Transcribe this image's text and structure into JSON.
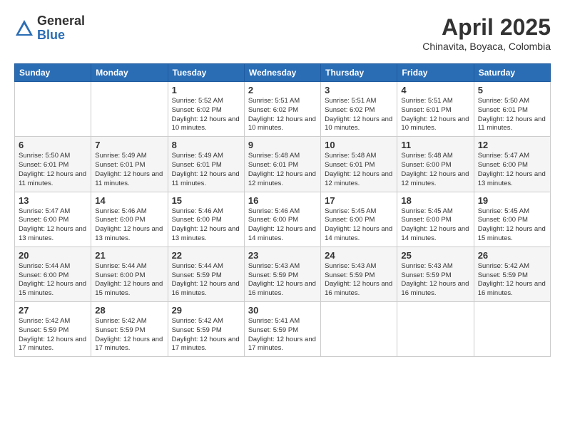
{
  "header": {
    "logo_general": "General",
    "logo_blue": "Blue",
    "month_year": "April 2025",
    "location": "Chinavita, Boyaca, Colombia"
  },
  "days_of_week": [
    "Sunday",
    "Monday",
    "Tuesday",
    "Wednesday",
    "Thursday",
    "Friday",
    "Saturday"
  ],
  "weeks": [
    [
      {
        "day": "",
        "info": ""
      },
      {
        "day": "",
        "info": ""
      },
      {
        "day": "1",
        "info": "Sunrise: 5:52 AM\nSunset: 6:02 PM\nDaylight: 12 hours and 10 minutes."
      },
      {
        "day": "2",
        "info": "Sunrise: 5:51 AM\nSunset: 6:02 PM\nDaylight: 12 hours and 10 minutes."
      },
      {
        "day": "3",
        "info": "Sunrise: 5:51 AM\nSunset: 6:02 PM\nDaylight: 12 hours and 10 minutes."
      },
      {
        "day": "4",
        "info": "Sunrise: 5:51 AM\nSunset: 6:01 PM\nDaylight: 12 hours and 10 minutes."
      },
      {
        "day": "5",
        "info": "Sunrise: 5:50 AM\nSunset: 6:01 PM\nDaylight: 12 hours and 11 minutes."
      }
    ],
    [
      {
        "day": "6",
        "info": "Sunrise: 5:50 AM\nSunset: 6:01 PM\nDaylight: 12 hours and 11 minutes."
      },
      {
        "day": "7",
        "info": "Sunrise: 5:49 AM\nSunset: 6:01 PM\nDaylight: 12 hours and 11 minutes."
      },
      {
        "day": "8",
        "info": "Sunrise: 5:49 AM\nSunset: 6:01 PM\nDaylight: 12 hours and 11 minutes."
      },
      {
        "day": "9",
        "info": "Sunrise: 5:48 AM\nSunset: 6:01 PM\nDaylight: 12 hours and 12 minutes."
      },
      {
        "day": "10",
        "info": "Sunrise: 5:48 AM\nSunset: 6:01 PM\nDaylight: 12 hours and 12 minutes."
      },
      {
        "day": "11",
        "info": "Sunrise: 5:48 AM\nSunset: 6:00 PM\nDaylight: 12 hours and 12 minutes."
      },
      {
        "day": "12",
        "info": "Sunrise: 5:47 AM\nSunset: 6:00 PM\nDaylight: 12 hours and 13 minutes."
      }
    ],
    [
      {
        "day": "13",
        "info": "Sunrise: 5:47 AM\nSunset: 6:00 PM\nDaylight: 12 hours and 13 minutes."
      },
      {
        "day": "14",
        "info": "Sunrise: 5:46 AM\nSunset: 6:00 PM\nDaylight: 12 hours and 13 minutes."
      },
      {
        "day": "15",
        "info": "Sunrise: 5:46 AM\nSunset: 6:00 PM\nDaylight: 12 hours and 13 minutes."
      },
      {
        "day": "16",
        "info": "Sunrise: 5:46 AM\nSunset: 6:00 PM\nDaylight: 12 hours and 14 minutes."
      },
      {
        "day": "17",
        "info": "Sunrise: 5:45 AM\nSunset: 6:00 PM\nDaylight: 12 hours and 14 minutes."
      },
      {
        "day": "18",
        "info": "Sunrise: 5:45 AM\nSunset: 6:00 PM\nDaylight: 12 hours and 14 minutes."
      },
      {
        "day": "19",
        "info": "Sunrise: 5:45 AM\nSunset: 6:00 PM\nDaylight: 12 hours and 15 minutes."
      }
    ],
    [
      {
        "day": "20",
        "info": "Sunrise: 5:44 AM\nSunset: 6:00 PM\nDaylight: 12 hours and 15 minutes."
      },
      {
        "day": "21",
        "info": "Sunrise: 5:44 AM\nSunset: 6:00 PM\nDaylight: 12 hours and 15 minutes."
      },
      {
        "day": "22",
        "info": "Sunrise: 5:44 AM\nSunset: 5:59 PM\nDaylight: 12 hours and 16 minutes."
      },
      {
        "day": "23",
        "info": "Sunrise: 5:43 AM\nSunset: 5:59 PM\nDaylight: 12 hours and 16 minutes."
      },
      {
        "day": "24",
        "info": "Sunrise: 5:43 AM\nSunset: 5:59 PM\nDaylight: 12 hours and 16 minutes."
      },
      {
        "day": "25",
        "info": "Sunrise: 5:43 AM\nSunset: 5:59 PM\nDaylight: 12 hours and 16 minutes."
      },
      {
        "day": "26",
        "info": "Sunrise: 5:42 AM\nSunset: 5:59 PM\nDaylight: 12 hours and 16 minutes."
      }
    ],
    [
      {
        "day": "27",
        "info": "Sunrise: 5:42 AM\nSunset: 5:59 PM\nDaylight: 12 hours and 17 minutes."
      },
      {
        "day": "28",
        "info": "Sunrise: 5:42 AM\nSunset: 5:59 PM\nDaylight: 12 hours and 17 minutes."
      },
      {
        "day": "29",
        "info": "Sunrise: 5:42 AM\nSunset: 5:59 PM\nDaylight: 12 hours and 17 minutes."
      },
      {
        "day": "30",
        "info": "Sunrise: 5:41 AM\nSunset: 5:59 PM\nDaylight: 12 hours and 17 minutes."
      },
      {
        "day": "",
        "info": ""
      },
      {
        "day": "",
        "info": ""
      },
      {
        "day": "",
        "info": ""
      }
    ]
  ]
}
